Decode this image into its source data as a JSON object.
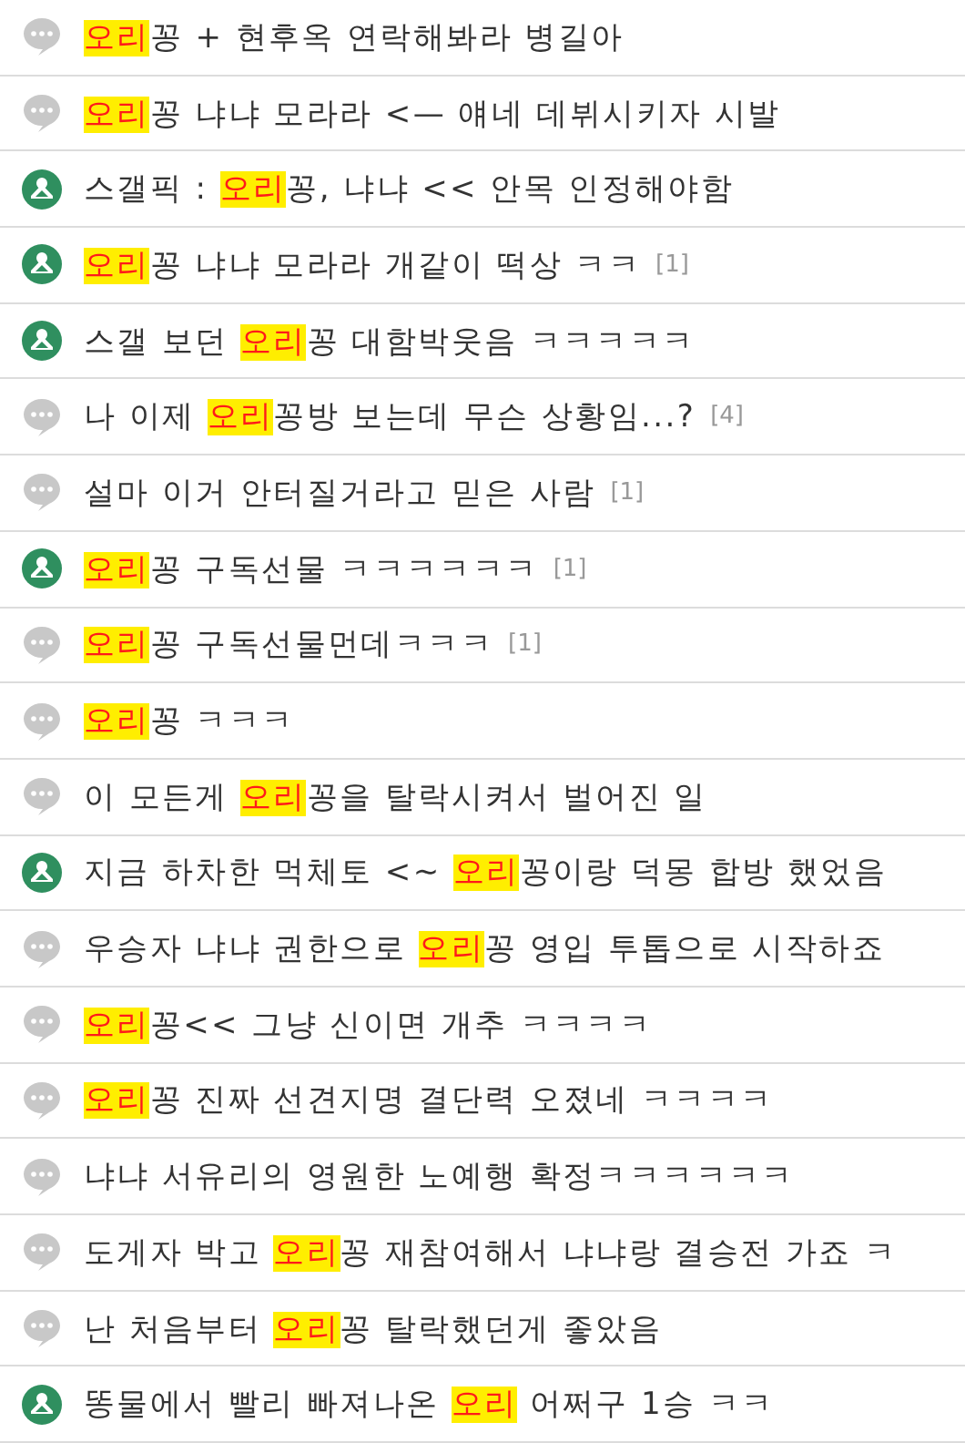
{
  "posts": [
    {
      "kind": "text",
      "parts": [
        {
          "text": "오리",
          "highlight": true
        },
        {
          "text": "꽁 + 현후옥 연락해봐라 병길아",
          "highlight": false
        }
      ]
    },
    {
      "kind": "text",
      "parts": [
        {
          "text": "오리",
          "highlight": true
        },
        {
          "text": "꽁 냐냐 모라라 <— 얘네 데뷔시키자 시발",
          "highlight": false
        }
      ]
    },
    {
      "kind": "image",
      "parts": [
        {
          "text": "스갤픽 : ",
          "highlight": false
        },
        {
          "text": "오리",
          "highlight": true
        },
        {
          "text": "꽁, 냐냐 << 안목 인정해야함",
          "highlight": false
        }
      ]
    },
    {
      "kind": "image",
      "parts": [
        {
          "text": "오리",
          "highlight": true
        },
        {
          "text": "꽁 냐냐 모라라 개같이 떡상 ㅋㅋ",
          "highlight": false
        }
      ],
      "comments": "[1]"
    },
    {
      "kind": "image",
      "parts": [
        {
          "text": "스갤 보던 ",
          "highlight": false
        },
        {
          "text": "오리",
          "highlight": true
        },
        {
          "text": "꽁 대함박웃음 ㅋㅋㅋㅋㅋ",
          "highlight": false
        }
      ]
    },
    {
      "kind": "text",
      "parts": [
        {
          "text": "나 이제 ",
          "highlight": false
        },
        {
          "text": "오리",
          "highlight": true
        },
        {
          "text": "꽁방 보는데 무슨 상황임...?",
          "highlight": false
        }
      ],
      "comments": "[4]"
    },
    {
      "kind": "text",
      "parts": [
        {
          "text": "설마 이거 안터질거라고 믿은 사람",
          "highlight": false
        }
      ],
      "comments": "[1]"
    },
    {
      "kind": "image",
      "parts": [
        {
          "text": "오리",
          "highlight": true
        },
        {
          "text": "꽁 구독선물 ㅋㅋㅋㅋㅋㅋ",
          "highlight": false
        }
      ],
      "comments": "[1]"
    },
    {
      "kind": "text",
      "parts": [
        {
          "text": "오리",
          "highlight": true
        },
        {
          "text": "꽁 구독선물먼데ㅋㅋㅋ",
          "highlight": false
        }
      ],
      "comments": "[1]"
    },
    {
      "kind": "text",
      "parts": [
        {
          "text": "오리",
          "highlight": true
        },
        {
          "text": "꽁 ㅋㅋㅋ",
          "highlight": false
        }
      ]
    },
    {
      "kind": "text",
      "parts": [
        {
          "text": "이 모든게 ",
          "highlight": false
        },
        {
          "text": "오리",
          "highlight": true
        },
        {
          "text": "꽁을 탈락시켜서 벌어진 일",
          "highlight": false
        }
      ]
    },
    {
      "kind": "image",
      "parts": [
        {
          "text": "지금 하차한 먹체토 <~ ",
          "highlight": false
        },
        {
          "text": "오리",
          "highlight": true
        },
        {
          "text": "꽁이랑 덕몽 합방 했었음",
          "highlight": false
        }
      ]
    },
    {
      "kind": "text",
      "parts": [
        {
          "text": "우승자 냐냐 권한으로 ",
          "highlight": false
        },
        {
          "text": "오리",
          "highlight": true
        },
        {
          "text": "꽁 영입 투톱으로 시작하죠",
          "highlight": false
        }
      ]
    },
    {
      "kind": "text",
      "parts": [
        {
          "text": "오리",
          "highlight": true
        },
        {
          "text": "꽁<< 그냥 신이면 개추 ㅋㅋㅋㅋ",
          "highlight": false
        }
      ]
    },
    {
      "kind": "text",
      "parts": [
        {
          "text": "오리",
          "highlight": true
        },
        {
          "text": "꽁 진짜 선견지명 결단력 오졌네 ㅋㅋㅋㅋ",
          "highlight": false
        }
      ]
    },
    {
      "kind": "text",
      "parts": [
        {
          "text": "냐냐 서유리의 영원한 노예행 확정ㅋㅋㅋㅋㅋㅋ",
          "highlight": false
        }
      ]
    },
    {
      "kind": "text",
      "parts": [
        {
          "text": "도게자 박고 ",
          "highlight": false
        },
        {
          "text": "오리",
          "highlight": true
        },
        {
          "text": "꽁 재참여해서 냐냐랑 결승전 가죠 ㅋ",
          "highlight": false
        }
      ]
    },
    {
      "kind": "text",
      "parts": [
        {
          "text": "난 처음부터 ",
          "highlight": false
        },
        {
          "text": "오리",
          "highlight": true
        },
        {
          "text": "꽁 탈락했던게 좋았음",
          "highlight": false
        }
      ]
    },
    {
      "kind": "image",
      "parts": [
        {
          "text": "똥물에서 빨리 빠져나온 ",
          "highlight": false
        },
        {
          "text": "오리",
          "highlight": true
        },
        {
          "text": " 어쩌구 1승 ㅋㅋ",
          "highlight": false
        }
      ]
    }
  ]
}
